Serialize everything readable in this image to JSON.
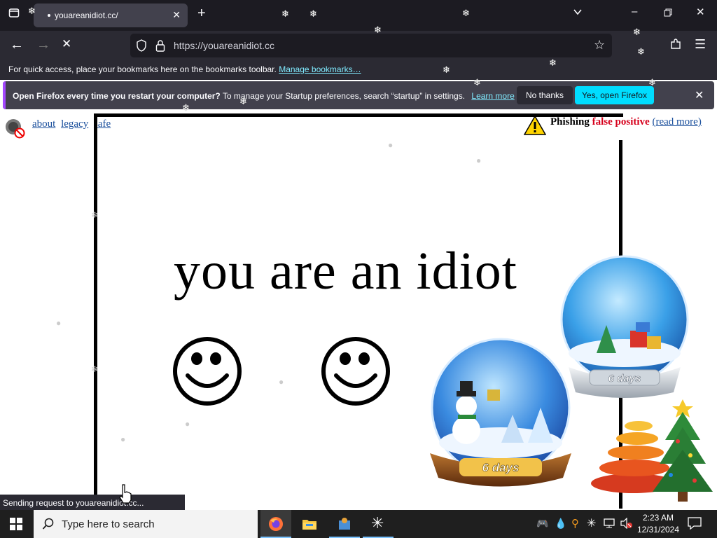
{
  "browser": {
    "tab_title": "youareanidiot.cc/",
    "url": "https://youareanidiot.cc",
    "bookmarks_text": "For quick access, place your bookmarks here on the bookmarks toolbar.",
    "bookmarks_link": "Manage bookmarks…",
    "notification": {
      "bold_text": "Open Firefox every time you restart your computer?",
      "text": "To manage your Startup preferences, search “startup” in settings.",
      "learn_more": "Learn more",
      "no_thanks": "No thanks",
      "yes_open": "Yes, open Firefox"
    },
    "status_text": "Sending request to youareanidiot.cc..."
  },
  "page": {
    "links": [
      "about",
      "legacy",
      "safe"
    ],
    "phishing": {
      "word1": "Phishing",
      "word2": "false positive",
      "read_more": "(read more)"
    },
    "headline": "you are an idiot",
    "globe_labels": [
      "6 days",
      "6 days"
    ]
  },
  "taskbar": {
    "search_placeholder": "Type here to search",
    "time": "2:23 AM",
    "date": "12/31/2024"
  },
  "icons": [
    "tab-list-icon",
    "new-tab-icon",
    "chevron-down-icon",
    "minimize-icon",
    "restore-icon",
    "close-icon",
    "back-icon",
    "forward-icon",
    "stop-icon",
    "shield-icon",
    "lock-icon",
    "star-icon",
    "extensions-icon",
    "menu-icon",
    "speaker-muted-icon",
    "warning-icon",
    "windows-start-icon",
    "search-icon",
    "firefox-icon",
    "file-explorer-icon",
    "notification-icon"
  ],
  "colors": {
    "accent": "#00ddff",
    "notif_stripe": "#a347ff",
    "link": "#1a4f9c",
    "red": "#d6001c"
  }
}
